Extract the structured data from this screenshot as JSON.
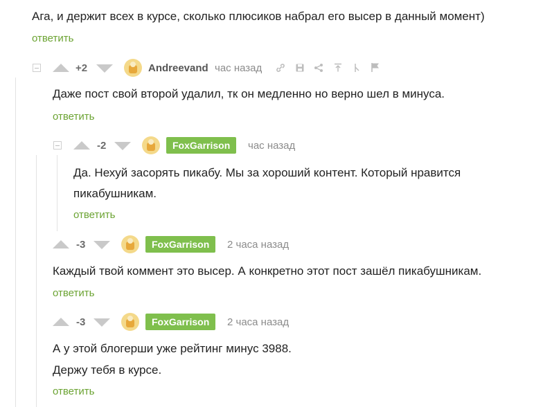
{
  "top_comment": {
    "text": "Ага, и держит всех в курсе, сколько плюсиков набрал его высер в данный момент)",
    "reply_label": "ответить"
  },
  "comments": [
    {
      "rating": "+2",
      "author": "Andreevand",
      "time": "час назад",
      "lines": [
        "Даже пост свой второй удалил, тк он медленно но верно шел в минуса."
      ],
      "reply_label": "ответить",
      "tools": [
        "link-icon",
        "save-icon",
        "share-icon",
        "scroll-up-icon",
        "branch-icon",
        "flag-icon"
      ]
    },
    {
      "rating": "-2",
      "author": "FoxGarrison",
      "time": "час назад",
      "lines": [
        "Да. Нехуй засорять пикабу. Мы за хороший контент. Который нравится",
        "пикабушникам."
      ],
      "reply_label": "ответить"
    },
    {
      "rating": "-3",
      "author": "FoxGarrison",
      "time": "2 часа назад",
      "lines": [
        "Каждый твой коммент это высер. А конкретно этот пост зашёл пикабушникам."
      ],
      "reply_label": "ответить"
    },
    {
      "rating": "-3",
      "author": "FoxGarrison",
      "time": "2 часа назад",
      "lines": [
        "А у этой блогерши уже рейтинг минус 3988.",
        "Держу тебя в курсе."
      ],
      "reply_label": "ответить"
    }
  ],
  "colors": {
    "accent_green": "#6ba332",
    "badge_green": "#7fbf4d",
    "muted": "#8b8b8b"
  }
}
